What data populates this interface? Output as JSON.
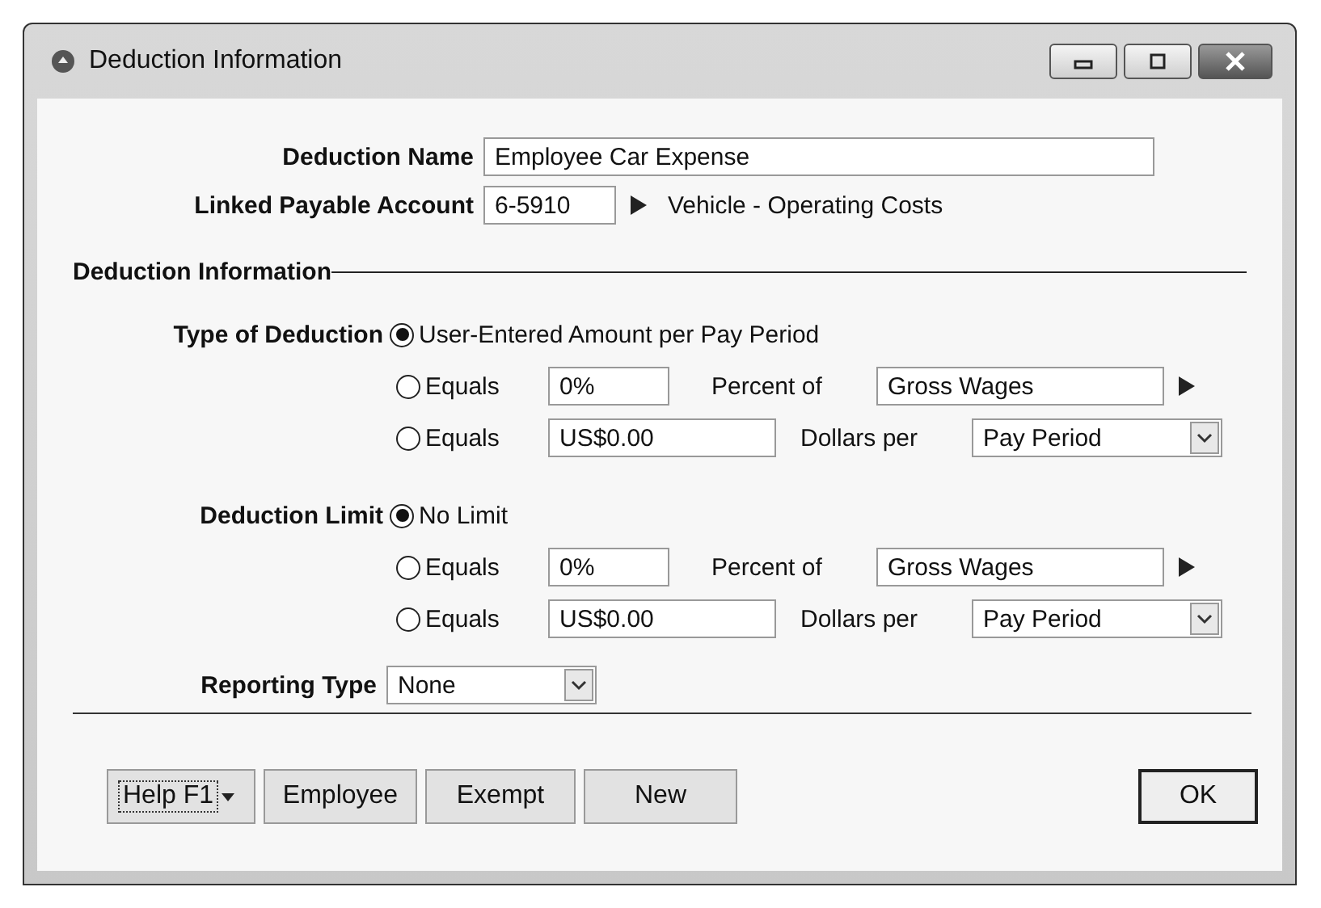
{
  "window": {
    "title": "Deduction Information"
  },
  "deduction_name": {
    "label": "Deduction Name",
    "value": "Employee Car Expense"
  },
  "linked_account": {
    "label": "Linked Payable Account",
    "value": "6-5910",
    "description": "Vehicle - Operating Costs"
  },
  "section_title": "Deduction Information",
  "groups": [
    {
      "label": "Type of Deduction",
      "options": [
        {
          "kind": "plain",
          "label": "User-Entered Amount per Pay Period",
          "selected": true
        },
        {
          "kind": "percent",
          "label": "Equals",
          "selected": false,
          "value": "0%",
          "unit": "Percent of",
          "basis": "Gross Wages"
        },
        {
          "kind": "dollars",
          "label": "Equals",
          "selected": false,
          "value": "US$0.00",
          "unit": "Dollars per",
          "basis": "Pay Period"
        }
      ]
    },
    {
      "label": "Deduction Limit",
      "options": [
        {
          "kind": "plain",
          "label": "No Limit",
          "selected": true
        },
        {
          "kind": "percent",
          "label": "Equals",
          "selected": false,
          "value": "0%",
          "unit": "Percent of",
          "basis": "Gross Wages"
        },
        {
          "kind": "dollars",
          "label": "Equals",
          "selected": false,
          "value": "US$0.00",
          "unit": "Dollars per",
          "basis": "Pay Period"
        }
      ]
    }
  ],
  "reporting_type": {
    "label": "Reporting Type",
    "value": "None"
  },
  "buttons": [
    {
      "label": "Help F1",
      "kind": "help"
    },
    {
      "label": "Employee",
      "kind": "plain"
    },
    {
      "label": "Exempt",
      "kind": "plain"
    },
    {
      "label": "New",
      "kind": "plain"
    }
  ],
  "ok_button": "OK"
}
